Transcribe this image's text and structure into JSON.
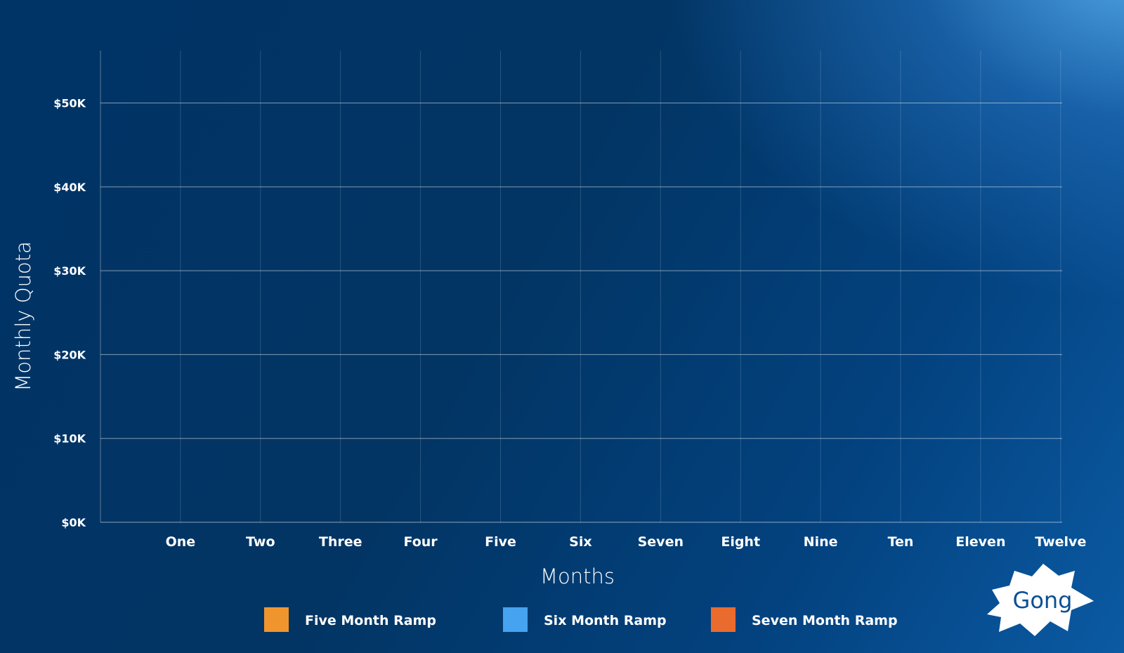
{
  "chart_data": {
    "type": "line",
    "title": "",
    "xlabel": "Months",
    "ylabel": "Monthly Quota",
    "categories": [
      "One",
      "Two",
      "Three",
      "Four",
      "Five",
      "Six",
      "Seven",
      "Eight",
      "Nine",
      "Ten",
      "Eleven",
      "Twelve"
    ],
    "yticks": [
      0,
      10000,
      20000,
      30000,
      40000,
      50000
    ],
    "ytick_labels": [
      "$0K",
      "$10K",
      "$20K",
      "$30K",
      "$40K",
      "$50K"
    ],
    "ylim": [
      0,
      56250
    ],
    "grid": true,
    "legend_position": "bottom",
    "series": [
      {
        "name": "Five Month Ramp",
        "color": "#f0952e",
        "values": []
      },
      {
        "name": "Six Month Ramp",
        "color": "#46a3ef",
        "values": []
      },
      {
        "name": "Seven Month Ramp",
        "color": "#ea6b2e",
        "values": []
      }
    ]
  },
  "logo": {
    "text": "Gong",
    "icon": "starburst-logo-icon"
  },
  "colors": {
    "background": "#023564",
    "gridline": "#ffffff",
    "text": "#ffffff",
    "logo_text": "#0b4f93"
  }
}
